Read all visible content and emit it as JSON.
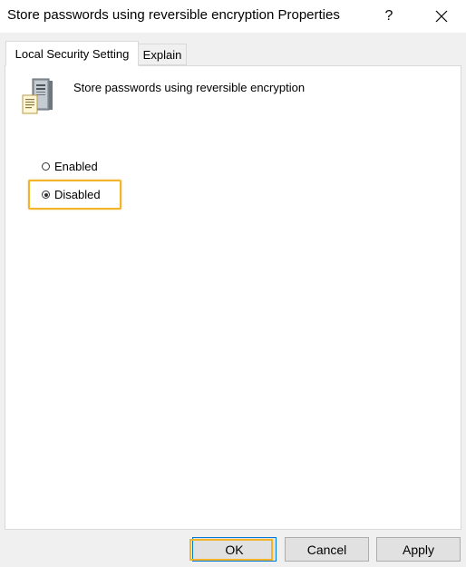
{
  "window": {
    "title": "Store passwords using reversible encryption Properties",
    "help_glyph": "?",
    "close_icon": "close-icon"
  },
  "tabs": [
    {
      "label": "Local Security Setting",
      "active": true
    },
    {
      "label": "Explain",
      "active": false
    }
  ],
  "policy": {
    "icon": "server-policy-icon",
    "name": "Store passwords using reversible encryption"
  },
  "options": {
    "enabled_label": "Enabled",
    "disabled_label": "Disabled",
    "selected": "Disabled"
  },
  "buttons": {
    "ok": "OK",
    "cancel": "Cancel",
    "apply": "Apply"
  },
  "colors": {
    "highlight": "#f2b42b",
    "focus_border": "#0078d7"
  }
}
